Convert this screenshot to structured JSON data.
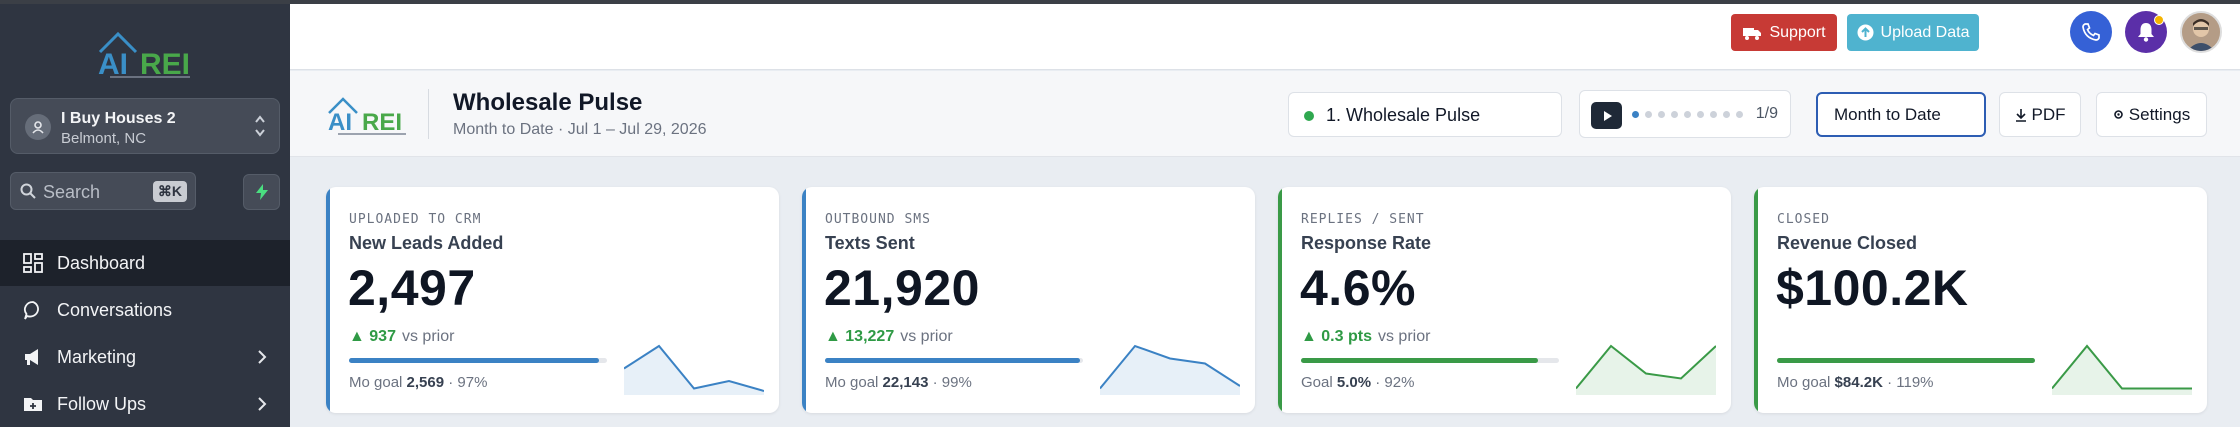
{
  "brand": {
    "logo_text": "AI REI"
  },
  "account": {
    "name": "I Buy Houses 2",
    "location": "Belmont, NC"
  },
  "search": {
    "placeholder": "Search",
    "shortcut": "⌘K"
  },
  "nav": [
    {
      "label": "Dashboard",
      "icon": "grid-icon",
      "active": true
    },
    {
      "label": "Conversations",
      "icon": "chat-bubble-icon"
    },
    {
      "label": "Marketing",
      "icon": "megaphone-icon",
      "chevron": true
    },
    {
      "label": "Follow Ups",
      "icon": "folder-plus-icon",
      "chevron": true
    }
  ],
  "topbar": {
    "support_label": "Support",
    "upload_label": "Upload Data"
  },
  "header": {
    "title": "Wholesale Pulse",
    "subtitle": "Month to Date · Jul 1 – Jul 29, 2026",
    "dashboard_select": "1. Wholesale Pulse",
    "page_count": "1/9",
    "current_page": 1,
    "total_pages": 9,
    "range_label": "Month to Date",
    "pdf_label": "PDF",
    "settings_label": "Settings"
  },
  "colors": {
    "blue": "#3b82c4",
    "green": "#3a9a47",
    "support": "#c73a35",
    "upload": "#4fb3cf"
  },
  "cards": [
    {
      "eyebrow": "UPLOADED TO CRM",
      "title": "New Leads Added",
      "value": "2,497",
      "delta": "▲ 937",
      "delta_note": "vs prior",
      "goal_prefix": "Mo goal",
      "goal_value": "2,569",
      "goal_pct": "· 97%",
      "progress": 0.97,
      "accent": "blue",
      "spark": [
        0.55,
        0.1,
        0.95,
        0.8,
        1.0
      ]
    },
    {
      "eyebrow": "OUTBOUND SMS",
      "title": "Texts Sent",
      "value": "21,920",
      "delta": "▲ 13,227",
      "delta_note": "vs prior",
      "goal_prefix": "Mo goal",
      "goal_value": "22,143",
      "goal_pct": "· 99%",
      "progress": 0.99,
      "accent": "blue",
      "spark": [
        0.95,
        0.1,
        0.35,
        0.45,
        0.9
      ]
    },
    {
      "eyebrow": "REPLIES / SENT",
      "title": "Response Rate",
      "value": "4.6%",
      "delta": "▲ 0.3 pts",
      "delta_note": "vs prior",
      "goal_prefix": "Goal",
      "goal_value": "5.0%",
      "goal_pct": "· 92%",
      "progress": 0.92,
      "accent": "green",
      "spark": [
        0.95,
        0.1,
        0.65,
        0.75,
        0.1
      ]
    },
    {
      "eyebrow": "CLOSED",
      "title": "Revenue Closed",
      "value": "$100.2K",
      "delta": "",
      "delta_note": "",
      "goal_prefix": "Mo goal",
      "goal_value": "$84.2K",
      "goal_pct": "· 119%",
      "progress": 1.0,
      "accent": "green",
      "spark": [
        0.95,
        0.1,
        0.95,
        0.95,
        0.95
      ]
    }
  ]
}
